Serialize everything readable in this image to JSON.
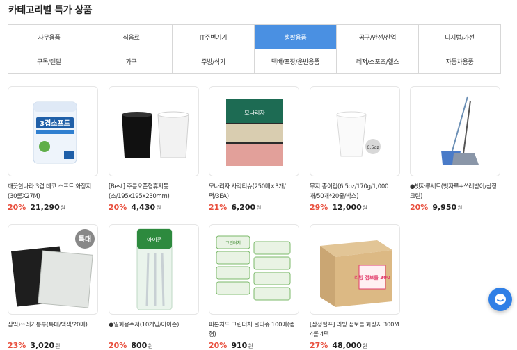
{
  "section_title": "카테고리별 특가 상품",
  "categories": [
    "사무용품",
    "식음료",
    "IT주변기기",
    "생활용품",
    "공구/안전/산업",
    "디지털/가전",
    "구독/렌탈",
    "가구",
    "주방/식기",
    "택배/포장/운반용품",
    "레저/스포츠/헬스",
    "자동차용품"
  ],
  "active_category": "생활용품",
  "products": [
    {
      "name": "깨끗한나라 3겹 데코 소프트 화장지 (30롤X27M)",
      "discount": "20%",
      "price": "21,290",
      "unit": "원",
      "image_text": "3겹소프트"
    },
    {
      "name": "[Best] 주름오픈형휴지통(소/195x195x230mm)",
      "discount": "20%",
      "price": "4,430",
      "unit": "원"
    },
    {
      "name": "모나리자 사각티슈(250매×3개/팩/3EA)",
      "discount": "21%",
      "price": "6,200",
      "unit": "원",
      "image_text": "모나리자"
    },
    {
      "name": "무지 종이컵(6.5oz/170g/1,000개/50개*20줄/박스)",
      "discount": "29%",
      "price": "12,000",
      "unit": "원",
      "image_text": "6.5oz"
    },
    {
      "name": "●빗자루세트(빗자루+쓰레받이/삼정크린)",
      "discount": "20%",
      "price": "9,950",
      "unit": "원"
    },
    {
      "name": "삼익)쓰레기봉투(특대/백색/20매)",
      "discount": "23%",
      "price": "3,020",
      "unit": "원",
      "image_text": "특대"
    },
    {
      "name": "●일회용수저(10개입/아이존)",
      "discount": "20%",
      "price": "800",
      "unit": "원",
      "image_text": "아이존"
    },
    {
      "name": "피톤치드 그린터치 물티슈 100매(캡형)",
      "discount": "20%",
      "price": "910",
      "unit": "원",
      "image_text": "그린터치"
    },
    {
      "name": "[삼정필프] 리빙 점보롤 화장지 300M 4롤 4팩",
      "discount": "27%",
      "price": "48,000",
      "unit": "원",
      "image_text": "리빙 점보롤 300"
    }
  ]
}
